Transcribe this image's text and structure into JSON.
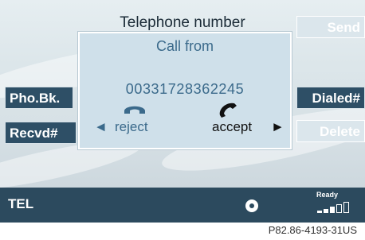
{
  "header": {
    "title": "Telephone number"
  },
  "softkeys": {
    "left": [
      {
        "label": "Pho.Bk.",
        "state": "active"
      },
      {
        "label": "Recvd#",
        "state": "active"
      }
    ],
    "right": [
      {
        "label": "Send",
        "state": "inactive"
      },
      {
        "label": "Dialed#",
        "state": "active"
      },
      {
        "label": "Delete",
        "state": "inactive"
      }
    ]
  },
  "dialog": {
    "heading": "Call from",
    "number": "00331728362245",
    "reject_label": "reject",
    "accept_label": "accept",
    "reject_arrow": "◄",
    "accept_arrow": "►",
    "reject_icon": "handset-hang-up-icon",
    "accept_icon": "handset-pick-up-icon"
  },
  "statusbar": {
    "mode": "TEL",
    "status": "Ready",
    "center_icon": "ring-icon",
    "signal_icon": "signal-strength-icon"
  },
  "caption": "P82.86-4193-31US",
  "colors": {
    "softkey_active_bg": "#2e4f66",
    "softkey_inactive_bg": "#dbe6ec",
    "dialog_bg": "#cfe0ea",
    "dialog_text": "#3b6a8b",
    "statusbar_bg": "#2c4a5e",
    "screen_bg": "#dce6ea"
  }
}
